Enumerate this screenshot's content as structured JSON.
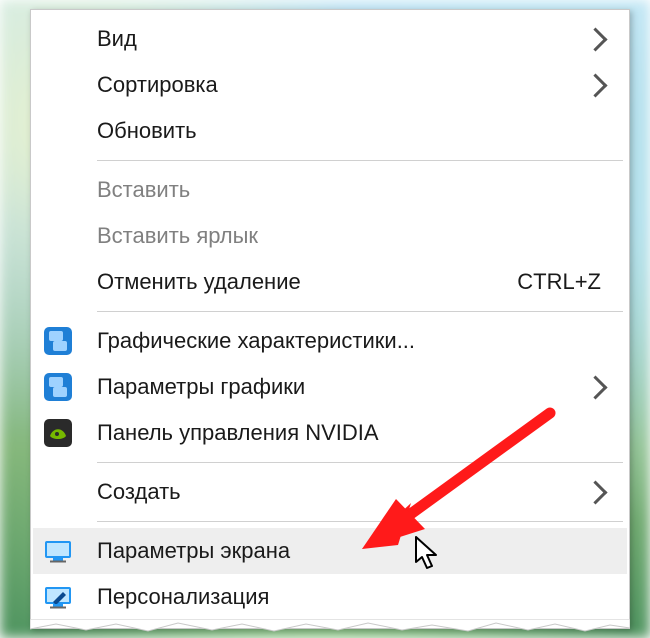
{
  "menu": {
    "items": [
      {
        "label": "Вид",
        "submenu": true,
        "disabled": false,
        "icon": null,
        "shortcut": null
      },
      {
        "label": "Сортировка",
        "submenu": true,
        "disabled": false,
        "icon": null,
        "shortcut": null
      },
      {
        "label": "Обновить",
        "submenu": false,
        "disabled": false,
        "icon": null,
        "shortcut": null
      },
      {
        "label": "Вставить",
        "submenu": false,
        "disabled": true,
        "icon": null,
        "shortcut": null
      },
      {
        "label": "Вставить ярлык",
        "submenu": false,
        "disabled": true,
        "icon": null,
        "shortcut": null
      },
      {
        "label": "Отменить удаление",
        "submenu": false,
        "disabled": false,
        "icon": null,
        "shortcut": "CTRL+Z"
      },
      {
        "label": "Графические характеристики...",
        "submenu": false,
        "disabled": false,
        "icon": "intel-graphics",
        "shortcut": null
      },
      {
        "label": "Параметры графики",
        "submenu": true,
        "disabled": false,
        "icon": "intel-graphics",
        "shortcut": null
      },
      {
        "label": "Панель управления NVIDIA",
        "submenu": false,
        "disabled": false,
        "icon": "nvidia",
        "shortcut": null
      },
      {
        "label": "Создать",
        "submenu": true,
        "disabled": false,
        "icon": null,
        "shortcut": null
      },
      {
        "label": "Параметры экрана",
        "submenu": false,
        "disabled": false,
        "icon": "display",
        "shortcut": null
      },
      {
        "label": "Персонализация",
        "submenu": false,
        "disabled": false,
        "icon": "personalization",
        "shortcut": null
      }
    ],
    "hovered_index": 10
  },
  "annotation": {
    "type": "arrow",
    "color": "#ff0000",
    "target_label": "Параметры экрана"
  }
}
